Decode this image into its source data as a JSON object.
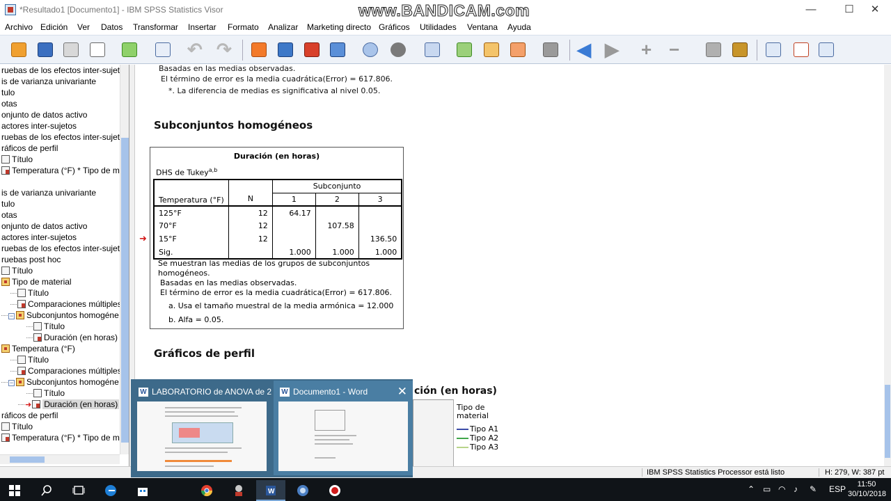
{
  "window": {
    "title": "*Resultado1 [Documento1] - IBM SPSS Statistics Visor",
    "watermark": "www.BANDICAM.com",
    "minimize": "—",
    "maximize": "☐",
    "close": "✕"
  },
  "menu": [
    "Archivo",
    "Edición",
    "Ver",
    "Datos",
    "Transformar",
    "Insertar",
    "Formato",
    "Analizar",
    "Marketing directo",
    "Gráficos",
    "Utilidades",
    "Ventana",
    "Ayuda"
  ],
  "toolbar": {
    "icons": [
      "open-icon",
      "save-icon",
      "print-icon",
      "print-preview-icon",
      "export-icon",
      "recall-dialog-icon",
      "undo-icon",
      "redo-icon",
      "goto-data-icon",
      "goto-case-icon",
      "goto-variable-icon",
      "variables-icon",
      "designate-window-icon",
      "show-all-icon",
      "hide-icon",
      "insert-output-icon",
      "promote-icon",
      "demote-icon",
      "expand-icon",
      "collapse-icon",
      "show-icon",
      "hide-book-icon",
      "heading-icon",
      "title-icon",
      "text-icon",
      "new-icon"
    ]
  },
  "nav": {
    "items": [
      {
        "label": "ruebas de los efectos inter-sujeto",
        "indent": 0,
        "icon": "none",
        "exp": ""
      },
      {
        "label": "is de varianza univariante",
        "indent": 0,
        "icon": "none",
        "exp": ""
      },
      {
        "label": "tulo",
        "indent": 0,
        "icon": "none",
        "exp": ""
      },
      {
        "label": "otas",
        "indent": 0,
        "icon": "none",
        "exp": ""
      },
      {
        "label": "onjunto de datos activo",
        "indent": 0,
        "icon": "none",
        "exp": ""
      },
      {
        "label": "actores inter-sujetos",
        "indent": 0,
        "icon": "none",
        "exp": ""
      },
      {
        "label": "ruebas de los efectos inter-sujeto",
        "indent": 0,
        "icon": "none",
        "exp": ""
      },
      {
        "label": "ráficos de perfil",
        "indent": 0,
        "icon": "none",
        "exp": ""
      },
      {
        "label": "Título",
        "indent": 0,
        "icon": "page",
        "exp": ""
      },
      {
        "label": "Temperatura (°F) * Tipo de ma",
        "indent": 0,
        "icon": "red",
        "exp": ""
      },
      {
        "label": "",
        "indent": 0,
        "icon": "none",
        "exp": ""
      },
      {
        "label": "is de varianza univariante",
        "indent": 0,
        "icon": "none",
        "exp": ""
      },
      {
        "label": "tulo",
        "indent": 0,
        "icon": "none",
        "exp": ""
      },
      {
        "label": "otas",
        "indent": 0,
        "icon": "none",
        "exp": ""
      },
      {
        "label": "onjunto de datos activo",
        "indent": 0,
        "icon": "none",
        "exp": ""
      },
      {
        "label": "actores inter-sujetos",
        "indent": 0,
        "icon": "none",
        "exp": ""
      },
      {
        "label": "ruebas de los efectos inter-sujeto",
        "indent": 0,
        "icon": "none",
        "exp": ""
      },
      {
        "label": "ruebas post hoc",
        "indent": 0,
        "icon": "none",
        "exp": ""
      },
      {
        "label": "Título",
        "indent": 0,
        "icon": "page",
        "exp": ""
      },
      {
        "label": "Tipo de material",
        "indent": 0,
        "icon": "book",
        "exp": ""
      },
      {
        "label": "Título",
        "indent": 1,
        "icon": "page",
        "exp": ""
      },
      {
        "label": "Comparaciones múltiples",
        "indent": 1,
        "icon": "red",
        "exp": ""
      },
      {
        "label": "Subconjuntos homogéne",
        "indent": 1,
        "icon": "book",
        "exp": "−"
      },
      {
        "label": "Título",
        "indent": 2,
        "icon": "page",
        "exp": ""
      },
      {
        "label": "Duración (en horas)",
        "indent": 2,
        "icon": "red",
        "exp": ""
      },
      {
        "label": "Temperatura (°F)",
        "indent": 0,
        "icon": "book",
        "exp": ""
      },
      {
        "label": "Título",
        "indent": 1,
        "icon": "page",
        "exp": ""
      },
      {
        "label": "Comparaciones múltiples",
        "indent": 1,
        "icon": "red",
        "exp": ""
      },
      {
        "label": "Subconjuntos homogéne",
        "indent": 1,
        "icon": "book",
        "exp": "−"
      },
      {
        "label": "Título",
        "indent": 2,
        "icon": "page",
        "exp": ""
      },
      {
        "label": "Duración (en horas)",
        "indent": 2,
        "icon": "red",
        "exp": "",
        "selected": true
      },
      {
        "label": "ráficos de perfil",
        "indent": 0,
        "icon": "none",
        "exp": ""
      },
      {
        "label": "Título",
        "indent": 0,
        "icon": "page",
        "exp": ""
      },
      {
        "label": "Temperatura (°F) * Tipo de ma",
        "indent": 0,
        "icon": "red",
        "exp": ""
      }
    ]
  },
  "content": {
    "top_notes": {
      "line1": "Basadas en las medias observadas.",
      "line2": "El término de error es la media cuadrática(Error) = 617.806.",
      "line3": "*. La diferencia de medias es significativa al nivel 0.05."
    },
    "section_subsets": "Subconjuntos homogéneos",
    "section_profile": "Gráficos de perfil",
    "chart_title_partial": "ción (en horas)",
    "table": {
      "title": "Duración (en horas)",
      "method": "DHS de Tukey",
      "method_sup": "a,b",
      "header_var": "Temperatura (°F)",
      "header_n": "N",
      "header_sub": "Subconjunto",
      "sub_cols": [
        "1",
        "2",
        "3"
      ],
      "rows": [
        {
          "label": "125°F",
          "n": "12",
          "c1": "64.17",
          "c2": "",
          "c3": ""
        },
        {
          "label": "70°F",
          "n": "12",
          "c1": "",
          "c2": "107.58",
          "c3": ""
        },
        {
          "label": "15°F",
          "n": "12",
          "c1": "",
          "c2": "",
          "c3": "136.50"
        },
        {
          "label": "Sig.",
          "n": "",
          "c1": "1.000",
          "c2": "1.000",
          "c3": "1.000"
        }
      ],
      "foot1a": "Se muestran las medias de los grupos de subconjuntos",
      "foot1b": "homogéneos.",
      "foot2": "Basadas en las medias observadas.",
      "foot3": "El término de error es la media cuadrática(Error) = 617.806.",
      "foot4": "a. Usa el tamaño muestral de la media armónica = 12.000",
      "foot5": "b. Alfa = 0.05."
    },
    "legend": {
      "title1": "Tipo de",
      "title2": "material",
      "items": [
        {
          "label": "Tipo A1",
          "color": "#3b4ca8"
        },
        {
          "label": "Tipo A2",
          "color": "#3fa64a"
        },
        {
          "label": "Tipo A3",
          "color": "#b8d48a"
        }
      ]
    }
  },
  "status": {
    "processor": "IBM SPSS Statistics Processor está listo",
    "dims": "H: 279, W: 387 pt"
  },
  "popup": {
    "card1": "LABORATORIO de ANOVA de 2 ...",
    "card2": "Documento1 - Word",
    "close": "✕",
    "word_letter": "W"
  },
  "taskbar": {
    "lang": "ESP",
    "time": "11:50",
    "date": "30/10/2018"
  }
}
